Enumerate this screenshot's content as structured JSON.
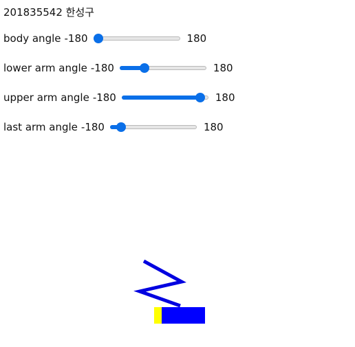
{
  "header": {
    "text": "201835542 한성구"
  },
  "controls": {
    "body": {
      "label": "body angle",
      "min": "-180",
      "max": "180",
      "value": -180
    },
    "lower_arm": {
      "label": "lower arm angle",
      "min": "-180",
      "max": "180",
      "value": -87
    },
    "upper_arm": {
      "label": "upper arm angle",
      "min": "-180",
      "max": "180",
      "value": 165
    },
    "last_arm": {
      "label": "last arm angle",
      "min": "-180",
      "max": "180",
      "value": -150
    }
  },
  "colors": {
    "accent": "#0a6fe8",
    "robot_body": "#0000ff",
    "robot_base": "#ffff00",
    "arm": "#0000e0"
  }
}
